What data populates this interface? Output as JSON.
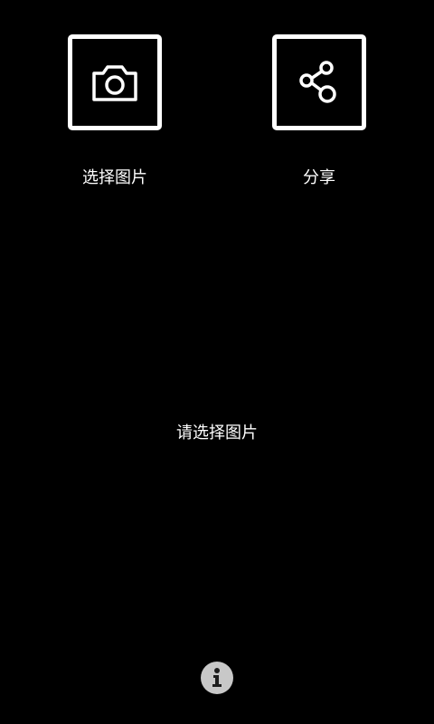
{
  "actions": {
    "select_image": {
      "label": "选择图片",
      "icon": "camera-icon"
    },
    "share": {
      "label": "分享",
      "icon": "share-icon"
    }
  },
  "main": {
    "placeholder_text": "请选择图片"
  },
  "footer": {
    "info_icon": "info-icon"
  },
  "colors": {
    "background": "#000000",
    "foreground": "#ffffff",
    "info_button_fill": "#c8c8c8",
    "info_glyph": "#1e1e1e"
  }
}
